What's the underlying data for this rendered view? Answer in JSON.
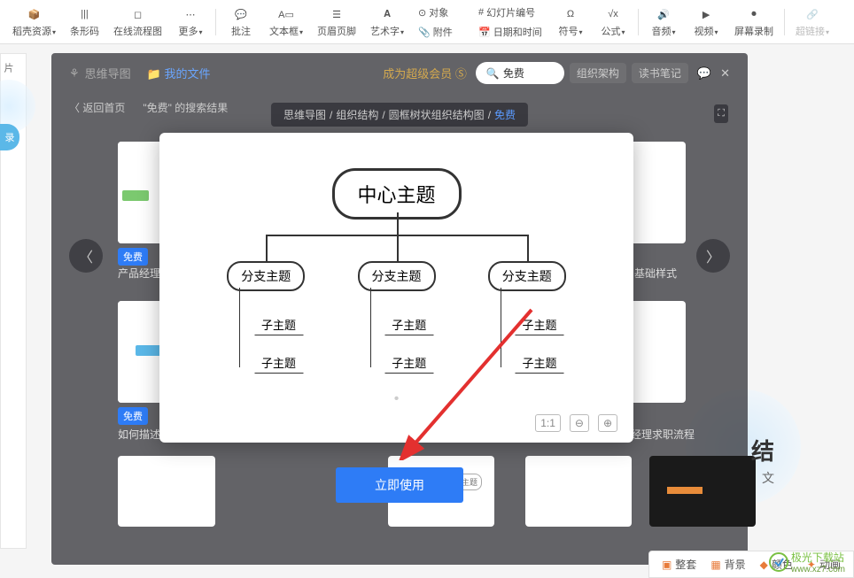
{
  "toolbar": {
    "items": [
      {
        "label": "稻壳资源"
      },
      {
        "label": "条形码"
      },
      {
        "label": "在线流程图"
      },
      {
        "label": "更多"
      },
      {
        "label": "批注"
      },
      {
        "label": "文本框"
      },
      {
        "label": "页眉页脚"
      },
      {
        "label": "艺术字"
      },
      {
        "label": "对象"
      },
      {
        "label": "附件"
      },
      {
        "label": "幻灯片编号"
      },
      {
        "label": "日期和时间"
      },
      {
        "label": "符号"
      },
      {
        "label": "公式"
      },
      {
        "label": "音频"
      },
      {
        "label": "视频"
      },
      {
        "label": "屏幕录制"
      },
      {
        "label": "超链接"
      }
    ]
  },
  "panel": {
    "tab1": "思维导图",
    "tab2": "我的文件",
    "premium": "成为超级会员",
    "search_placeholder": "免费",
    "pill1": "组织架构",
    "pill2": "读书笔记",
    "back": "返回首页",
    "search_result_label": "\"免费\" 的搜索结果"
  },
  "breadcrumb": {
    "p1": "思维导图",
    "p2": "组织结构",
    "p3": "圆框树状组织结构图",
    "p4": "免费"
  },
  "diagram": {
    "center": "中心主题",
    "branch": "分支主题",
    "leaf": "子主题"
  },
  "cards": {
    "free": "免费",
    "c1": "产品经理规范输出",
    "c2": "基础样式",
    "c3": "如何描述一件…",
    "c4": "品经理求职流程"
  },
  "buttons": {
    "use_now": "立即使用"
  },
  "bottom": {
    "b1": "整套",
    "b2": "背景",
    "b3": "颜色",
    "b4": "动画"
  },
  "watermark": {
    "name": "极光下载站",
    "url": "www.xz7.com"
  },
  "left_strip": "片"
}
